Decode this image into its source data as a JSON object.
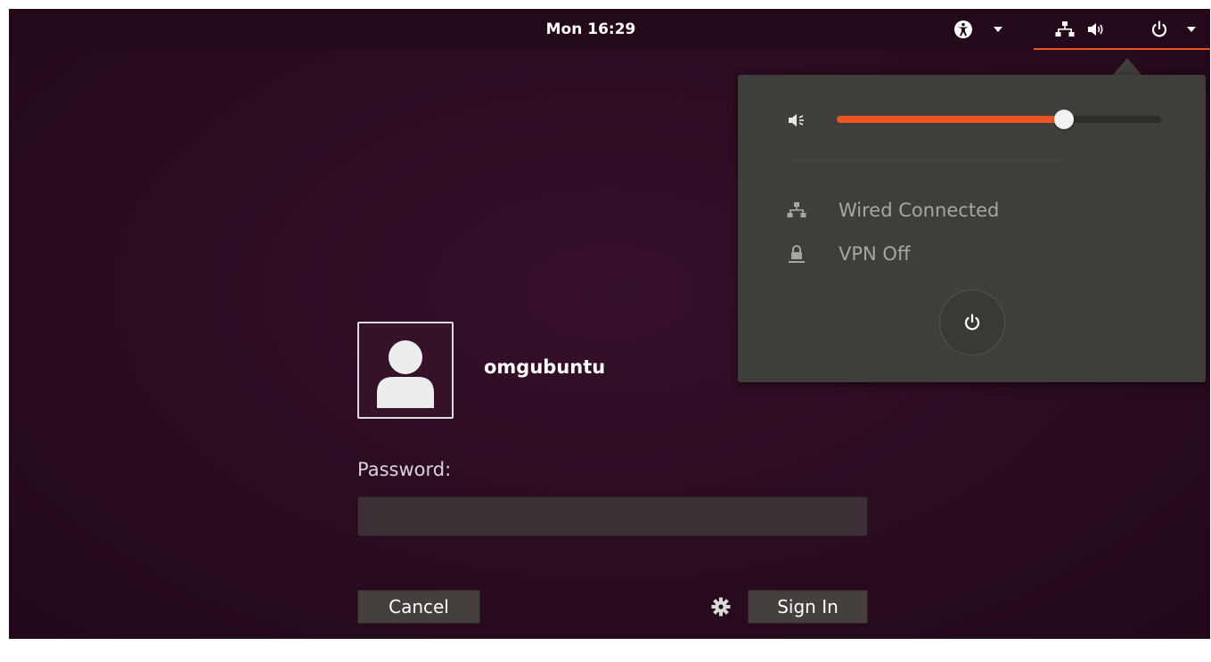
{
  "topbar": {
    "clock": "Mon 16:29",
    "icons": [
      "accessibility-icon",
      "network-wired-icon",
      "volume-icon",
      "power-icon"
    ]
  },
  "system_menu": {
    "volume": {
      "icon": "volume-low-icon",
      "level": 0.7
    },
    "network": {
      "icon": "network-wired-icon",
      "label": "Wired Connected"
    },
    "vpn": {
      "icon": "vpn-lock-icon",
      "label": "VPN Off"
    },
    "power_button_icon": "power-icon"
  },
  "login": {
    "username": "omgubuntu",
    "password_label": "Password:",
    "password_value": "",
    "cancel_label": "Cancel",
    "signin_label": "Sign In",
    "session_icon": "gear-icon"
  },
  "colors": {
    "accent": "#e95420",
    "background": "#2a0a1f",
    "menu_background": "#403e3a"
  }
}
